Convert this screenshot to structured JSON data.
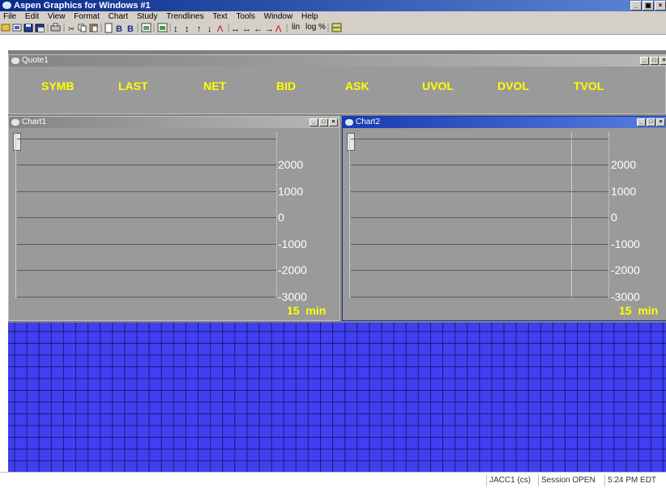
{
  "app": {
    "title": "Aspen Graphics for Windows #1"
  },
  "menu": [
    "File",
    "Edit",
    "View",
    "Format",
    "Chart",
    "Study",
    "Trendlines",
    "Text",
    "Tools",
    "Window",
    "Help"
  ],
  "toolbar": {
    "lin_label": "lin",
    "log_label": "log",
    "pct_label": "%"
  },
  "quote": {
    "title": "Quote1",
    "columns": [
      "SYMB",
      "LAST",
      "NET",
      "BID",
      "ASK",
      "UVOL",
      "DVOL",
      "TVOL"
    ]
  },
  "chart1": {
    "title": "Chart1",
    "y_labels": [
      "2000",
      "1000",
      "0",
      "-1000",
      "-2000",
      "-3000"
    ],
    "interval": "15",
    "interval_unit": "min"
  },
  "chart2": {
    "title": "Chart2",
    "y_labels": [
      "2000",
      "1000",
      "0",
      "-1000",
      "-2000",
      "-3000"
    ],
    "interval": "15",
    "interval_unit": "min"
  },
  "status": {
    "user": "JACC1 (cs)",
    "session": "Session OPEN",
    "time": "5:24 PM EDT"
  },
  "colors": {
    "title_blue": "#0a2a8a",
    "quote_header": "#ffff00",
    "grid_blue": "#4040f0",
    "chart_bg": "#9a9a9a"
  },
  "icons": [
    "app-icon",
    "minimize-icon",
    "maximize-icon",
    "close-icon",
    "open-icon",
    "save-icon",
    "print-icon",
    "cut-icon",
    "copy-icon",
    "paste-icon"
  ]
}
